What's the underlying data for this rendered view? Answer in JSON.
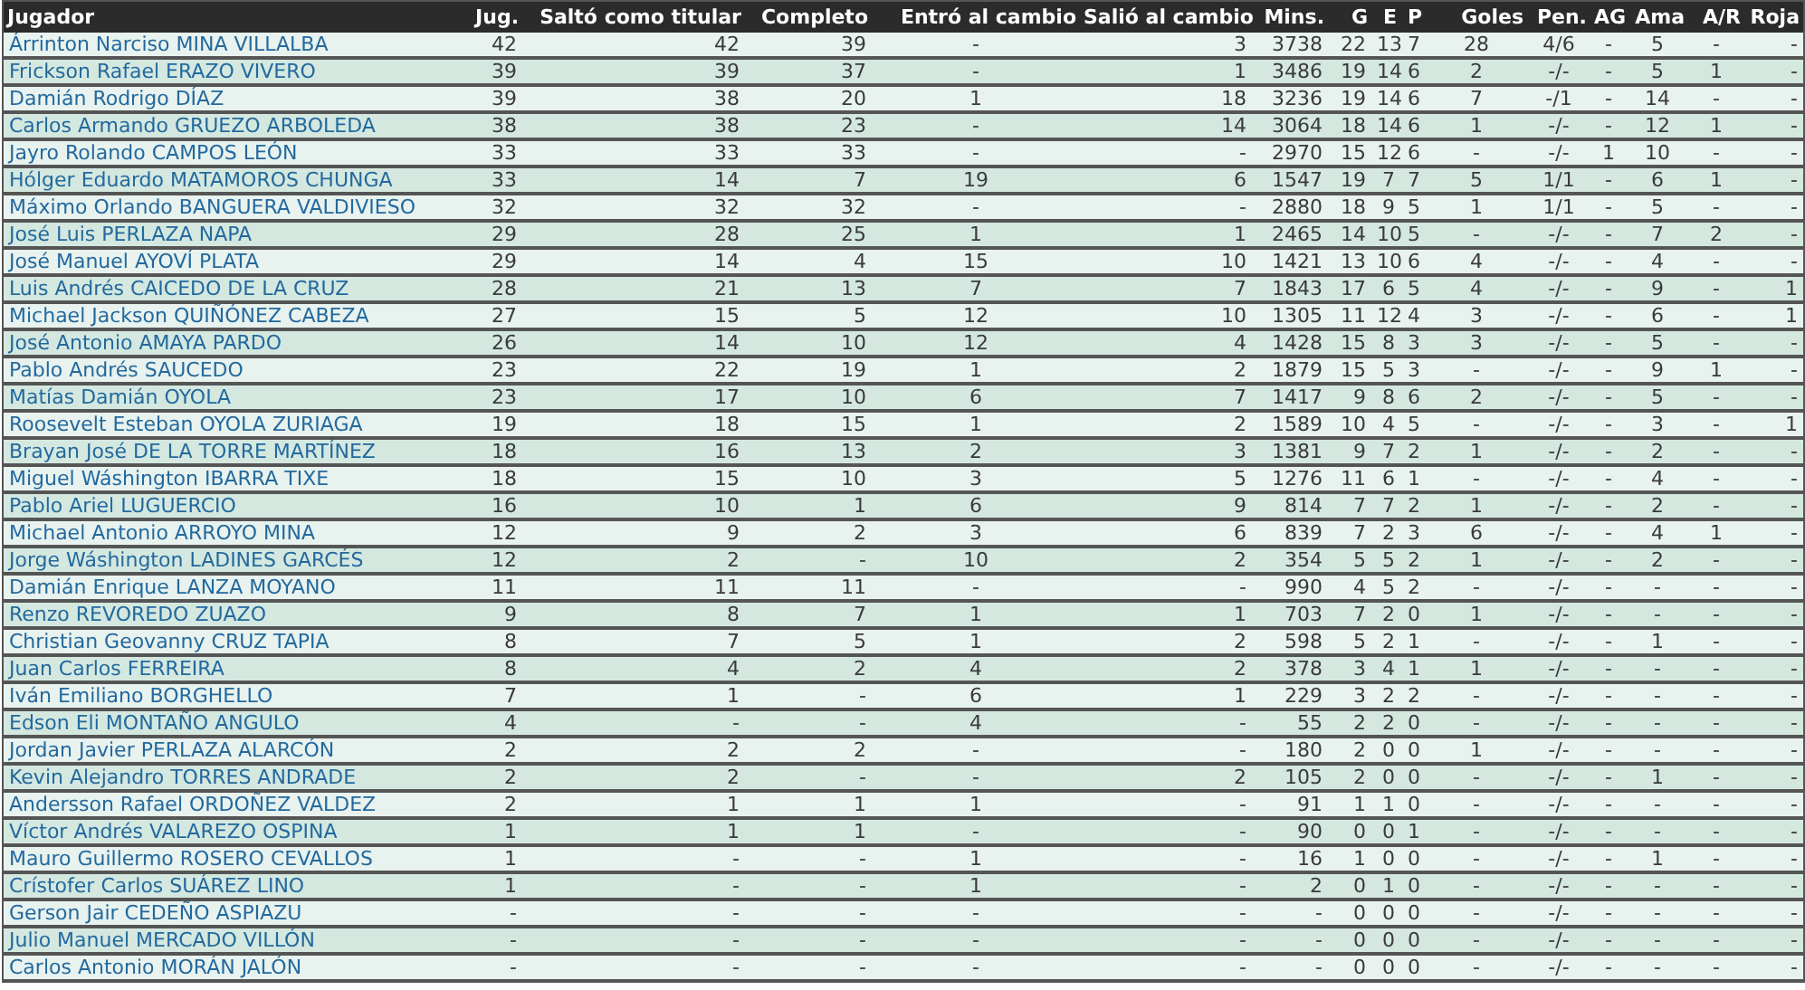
{
  "table": {
    "columns": [
      "Jugador",
      "Jug.",
      "Saltó como titular",
      "Completo",
      "Entró al cambio",
      "Salió al cambio",
      "Mins.",
      "G",
      "E",
      "P",
      "Goles",
      "Pen.",
      "AG",
      "Ama",
      "A/R",
      "Roja"
    ],
    "rows": [
      {
        "cells": [
          "Árrinton Narciso MINA VILLALBA",
          "42",
          "42",
          "39",
          "-",
          "3",
          "3738",
          "22",
          "13",
          "7",
          "28",
          "4/6",
          "-",
          "5",
          "-",
          "-"
        ]
      },
      {
        "cells": [
          "Frickson Rafael ERAZO VIVERO",
          "39",
          "39",
          "37",
          "-",
          "1",
          "3486",
          "19",
          "14",
          "6",
          "2",
          "-/-",
          "-",
          "5",
          "1",
          "-"
        ]
      },
      {
        "cells": [
          "Damián Rodrigo DÍAZ",
          "39",
          "38",
          "20",
          "1",
          "18",
          "3236",
          "19",
          "14",
          "6",
          "7",
          "-/1",
          "-",
          "14",
          "-",
          "-"
        ]
      },
      {
        "cells": [
          "Carlos Armando GRUEZO ARBOLEDA",
          "38",
          "38",
          "23",
          "-",
          "14",
          "3064",
          "18",
          "14",
          "6",
          "1",
          "-/-",
          "-",
          "12",
          "1",
          "-"
        ]
      },
      {
        "cells": [
          "Jayro Rolando CAMPOS LEÓN",
          "33",
          "33",
          "33",
          "-",
          "-",
          "2970",
          "15",
          "12",
          "6",
          "-",
          "-/-",
          "1",
          "10",
          "-",
          "-"
        ]
      },
      {
        "cells": [
          "Hólger Eduardo MATAMOROS CHUNGA",
          "33",
          "14",
          "7",
          "19",
          "6",
          "1547",
          "19",
          "7",
          "7",
          "5",
          "1/1",
          "-",
          "6",
          "1",
          "-"
        ]
      },
      {
        "cells": [
          "Máximo Orlando BANGUERA VALDIVIESO",
          "32",
          "32",
          "32",
          "-",
          "-",
          "2880",
          "18",
          "9",
          "5",
          "1",
          "1/1",
          "-",
          "5",
          "-",
          "-"
        ]
      },
      {
        "cells": [
          "José Luis PERLAZA NAPA",
          "29",
          "28",
          "25",
          "1",
          "1",
          "2465",
          "14",
          "10",
          "5",
          "-",
          "-/-",
          "-",
          "7",
          "2",
          "-"
        ]
      },
      {
        "cells": [
          "José Manuel AYOVÍ PLATA",
          "29",
          "14",
          "4",
          "15",
          "10",
          "1421",
          "13",
          "10",
          "6",
          "4",
          "-/-",
          "-",
          "4",
          "-",
          "-"
        ]
      },
      {
        "cells": [
          "Luis Andrés CAICEDO DE LA CRUZ",
          "28",
          "21",
          "13",
          "7",
          "7",
          "1843",
          "17",
          "6",
          "5",
          "4",
          "-/-",
          "-",
          "9",
          "-",
          "1"
        ]
      },
      {
        "cells": [
          "Michael Jackson QUIÑÓNEZ CABEZA",
          "27",
          "15",
          "5",
          "12",
          "10",
          "1305",
          "11",
          "12",
          "4",
          "3",
          "-/-",
          "-",
          "6",
          "-",
          "1"
        ]
      },
      {
        "cells": [
          "José Antonio AMAYA PARDO",
          "26",
          "14",
          "10",
          "12",
          "4",
          "1428",
          "15",
          "8",
          "3",
          "3",
          "-/-",
          "-",
          "5",
          "-",
          "-"
        ]
      },
      {
        "cells": [
          "Pablo Andrés SAUCEDO",
          "23",
          "22",
          "19",
          "1",
          "2",
          "1879",
          "15",
          "5",
          "3",
          "-",
          "-/-",
          "-",
          "9",
          "1",
          "-"
        ]
      },
      {
        "cells": [
          "Matías Damián OYOLA",
          "23",
          "17",
          "10",
          "6",
          "7",
          "1417",
          "9",
          "8",
          "6",
          "2",
          "-/-",
          "-",
          "5",
          "-",
          "-"
        ]
      },
      {
        "cells": [
          "Roosevelt Esteban OYOLA ZURIAGA",
          "19",
          "18",
          "15",
          "1",
          "2",
          "1589",
          "10",
          "4",
          "5",
          "-",
          "-/-",
          "-",
          "3",
          "-",
          "1"
        ]
      },
      {
        "cells": [
          "Brayan José DE LA TORRE MARTÍNEZ",
          "18",
          "16",
          "13",
          "2",
          "3",
          "1381",
          "9",
          "7",
          "2",
          "1",
          "-/-",
          "-",
          "2",
          "-",
          "-"
        ]
      },
      {
        "cells": [
          "Miguel Wáshington IBARRA TIXE",
          "18",
          "15",
          "10",
          "3",
          "5",
          "1276",
          "11",
          "6",
          "1",
          "-",
          "-/-",
          "-",
          "4",
          "-",
          "-"
        ]
      },
      {
        "cells": [
          "Pablo Ariel LUGUERCIO",
          "16",
          "10",
          "1",
          "6",
          "9",
          "814",
          "7",
          "7",
          "2",
          "1",
          "-/-",
          "-",
          "2",
          "-",
          "-"
        ]
      },
      {
        "cells": [
          "Michael Antonio ARROYO MINA",
          "12",
          "9",
          "2",
          "3",
          "6",
          "839",
          "7",
          "2",
          "3",
          "6",
          "-/-",
          "-",
          "4",
          "1",
          "-"
        ]
      },
      {
        "cells": [
          "Jorge Wáshington LADINES GARCÉS",
          "12",
          "2",
          "-",
          "10",
          "2",
          "354",
          "5",
          "5",
          "2",
          "1",
          "-/-",
          "-",
          "2",
          "-",
          "-"
        ]
      },
      {
        "cells": [
          "Damián Enrique LANZA MOYANO",
          "11",
          "11",
          "11",
          "-",
          "-",
          "990",
          "4",
          "5",
          "2",
          "-",
          "-/-",
          "-",
          "-",
          "-",
          "-"
        ]
      },
      {
        "cells": [
          "Renzo REVOREDO ZUAZO",
          "9",
          "8",
          "7",
          "1",
          "1",
          "703",
          "7",
          "2",
          "0",
          "1",
          "-/-",
          "-",
          "-",
          "-",
          "-"
        ]
      },
      {
        "cells": [
          "Christian Geovanny CRUZ TAPIA",
          "8",
          "7",
          "5",
          "1",
          "2",
          "598",
          "5",
          "2",
          "1",
          "-",
          "-/-",
          "-",
          "1",
          "-",
          "-"
        ]
      },
      {
        "cells": [
          "Juan Carlos FERREIRA",
          "8",
          "4",
          "2",
          "4",
          "2",
          "378",
          "3",
          "4",
          "1",
          "1",
          "-/-",
          "-",
          "-",
          "-",
          "-"
        ]
      },
      {
        "cells": [
          "Iván Emiliano BORGHELLO",
          "7",
          "1",
          "-",
          "6",
          "1",
          "229",
          "3",
          "2",
          "2",
          "-",
          "-/-",
          "-",
          "-",
          "-",
          "-"
        ]
      },
      {
        "cells": [
          "Edson Eli MONTAÑO ANGULO",
          "4",
          "-",
          "-",
          "4",
          "-",
          "55",
          "2",
          "2",
          "0",
          "-",
          "-/-",
          "-",
          "-",
          "-",
          "-"
        ]
      },
      {
        "cells": [
          "Jordan Javier PERLAZA ALARCÓN",
          "2",
          "2",
          "2",
          "-",
          "-",
          "180",
          "2",
          "0",
          "0",
          "1",
          "-/-",
          "-",
          "-",
          "-",
          "-"
        ]
      },
      {
        "cells": [
          "Kevin Alejandro TORRES ANDRADE",
          "2",
          "2",
          "-",
          "-",
          "2",
          "105",
          "2",
          "0",
          "0",
          "-",
          "-/-",
          "-",
          "1",
          "-",
          "-"
        ]
      },
      {
        "cells": [
          "Andersson Rafael ORDOÑEZ VALDEZ",
          "2",
          "1",
          "1",
          "1",
          "-",
          "91",
          "1",
          "1",
          "0",
          "-",
          "-/-",
          "-",
          "-",
          "-",
          "-"
        ]
      },
      {
        "cells": [
          "Víctor Andrés VALAREZO OSPINA",
          "1",
          "1",
          "1",
          "-",
          "-",
          "90",
          "0",
          "0",
          "1",
          "-",
          "-/-",
          "-",
          "-",
          "-",
          "-"
        ]
      },
      {
        "cells": [
          "Mauro Guillermo ROSERO CEVALLOS",
          "1",
          "-",
          "-",
          "1",
          "-",
          "16",
          "1",
          "0",
          "0",
          "-",
          "-/-",
          "-",
          "1",
          "-",
          "-"
        ]
      },
      {
        "cells": [
          "Crístofer Carlos SUÁREZ LINO",
          "1",
          "-",
          "-",
          "1",
          "-",
          "2",
          "0",
          "1",
          "0",
          "-",
          "-/-",
          "-",
          "-",
          "-",
          "-"
        ]
      },
      {
        "cells": [
          "Gerson Jair CEDEÑO ASPIAZU",
          "-",
          "-",
          "-",
          "-",
          "-",
          "-",
          "0",
          "0",
          "0",
          "-",
          "-/-",
          "-",
          "-",
          "-",
          "-"
        ]
      },
      {
        "cells": [
          "Julio Manuel MERCADO VILLÓN",
          "-",
          "-",
          "-",
          "-",
          "-",
          "-",
          "0",
          "0",
          "0",
          "-",
          "-/-",
          "-",
          "-",
          "-",
          "-"
        ]
      },
      {
        "cells": [
          "Carlos Antonio MORÁN JALÓN",
          "-",
          "-",
          "-",
          "-",
          "-",
          "-",
          "0",
          "0",
          "0",
          "-",
          "-/-",
          "-",
          "-",
          "-",
          "-"
        ]
      }
    ]
  }
}
